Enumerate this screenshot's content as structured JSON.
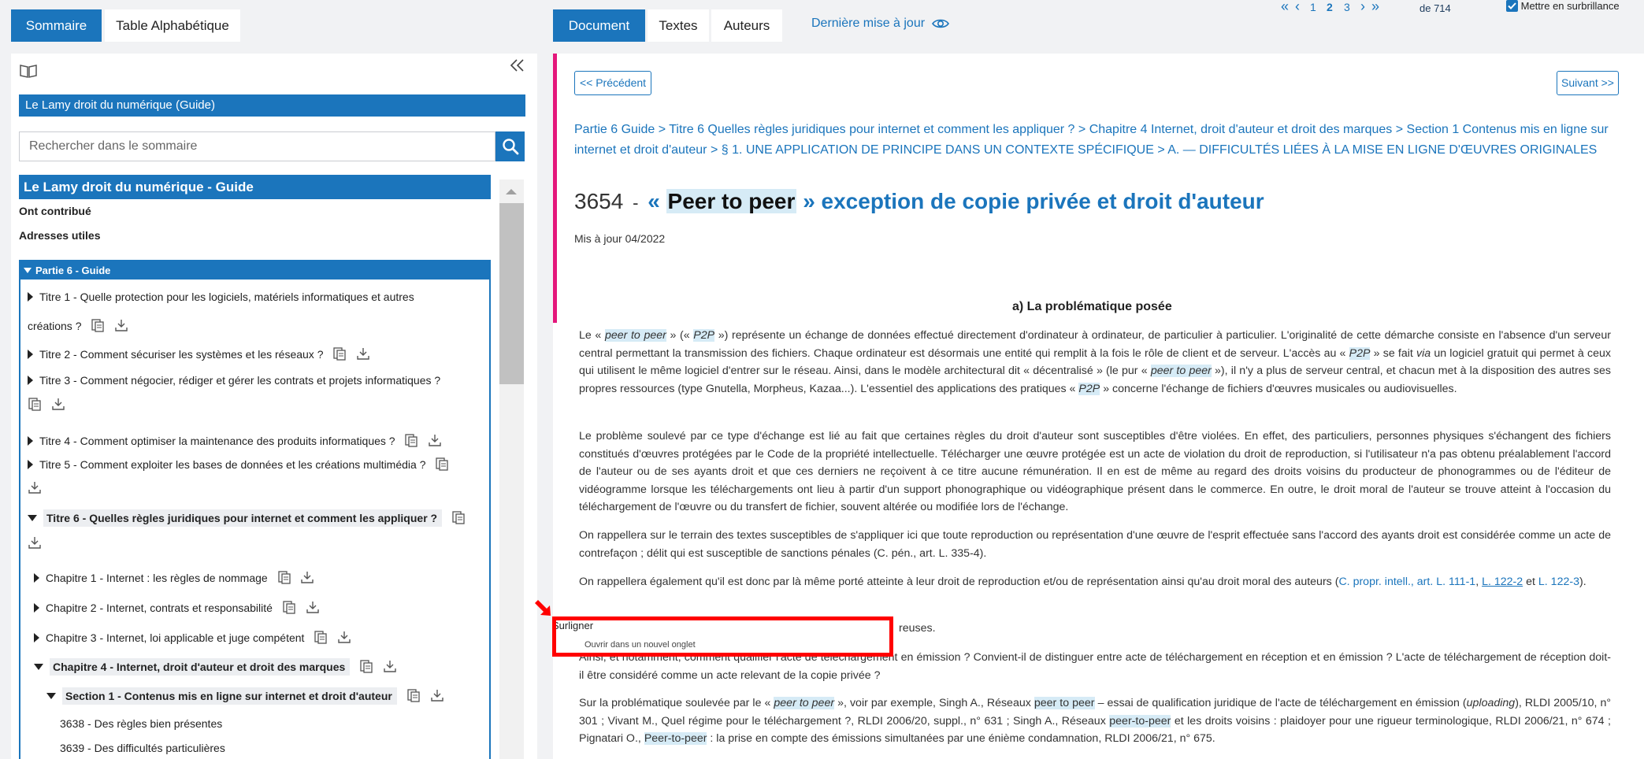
{
  "left_tabs": [
    "Sommaire",
    "Table Alphabétique"
  ],
  "right_tabs": [
    "Document",
    "Textes",
    "Auteurs"
  ],
  "last_update_label": "Dernière mise à jour",
  "pager": {
    "pages": [
      "1",
      "2",
      "3"
    ],
    "current": "2",
    "total": "de 714"
  },
  "highlight_checkbox": {
    "label": "Mettre en surbrillance",
    "checked": true
  },
  "sidebar": {
    "book_title": "Le Lamy droit du numérique (Guide)",
    "search_placeholder": "Rechercher dans le sommaire",
    "toc_header": "Le Lamy droit du numérique - Guide",
    "links": [
      "Ont contribué",
      "Adresses utiles"
    ],
    "part_label": "Partie 6 - Guide",
    "titles": [
      {
        "line1": "Titre 1 - Quelle protection pour les logiciels, matériels informatiques et autres",
        "line2": "créations ?"
      },
      {
        "line1": "Titre 2 - Comment sécuriser les systèmes et les réseaux ?"
      },
      {
        "line1": "Titre 3 - Comment négocier, rédiger et gérer les contrats et projets informatiques ?"
      },
      {
        "line1": "Titre 4 - Comment optimiser la maintenance des produits informatiques ?"
      },
      {
        "line1": "Titre 5 - Comment exploiter les bases de données et les créations multimédia ?"
      },
      {
        "line1": "Titre 6 - Quelles règles juridiques pour internet et comment les appliquer ?"
      }
    ],
    "chapters": [
      "Chapitre 1 - Internet : les règles de nommage",
      "Chapitre 2 - Internet, contrats et responsabilité",
      "Chapitre 3 - Internet, loi applicable et juge compétent",
      "Chapitre 4 - Internet, droit d'auteur et droit des marques"
    ],
    "section": "Section 1 - Contenus mis en ligne sur internet et droit d'auteur",
    "items": [
      "3638 - Des règles bien présentes",
      "3639 - Des difficultés particulières"
    ]
  },
  "doc": {
    "prev": "<< Précédent",
    "next": "Suivant >>",
    "breadcrumb": "Partie 6 Guide > Titre 6 Quelles règles juridiques pour internet et comment les appliquer ? > Chapitre 4 Internet, droit d'auteur et droit des marques > Section 1 Contenus mis en ligne sur internet et droit d'auteur > § 1. UNE APPLICATION DE PRINCIPE DANS UN CONTEXTE SPÉCIFIQUE > A. — DIFFICULTÉS LIÉES À LA MISE EN LIGNE D'ŒUVRES ORIGINALES",
    "number": "3654",
    "dash": "-",
    "title_open": "«",
    "title_kw": "Peer to peer",
    "title_rest": "» exception de copie privée et droit d'auteur",
    "updated": "Mis à jour 04/2022",
    "section_heading": "a) La problématique posée",
    "p1": {
      "t1": "Le «",
      "k1": "peer to peer",
      "t2": "» («",
      "k2": "P2P",
      "t3": "») représente un échange de données effectué directement d'ordinateur à ordinateur, de particulier à particulier. L'originalité de cette démarche consiste en l'absence d'un serveur central permettant la transmission des fichiers. Chaque ordinateur est désormais une entité qui remplit à la fois le rôle de client et de serveur. L'accès au «",
      "k3": "P2P",
      "t4": "» se fait",
      "via": "via",
      "t5": "un logiciel gratuit qui permet à ceux qui utilisent le même logiciel d'entrer sur le réseau. Ainsi, dans le modèle architectural dit « décentralisé » (le pur «",
      "k4": "peer to peer",
      "t6": "»), il n'y a plus de serveur central, et chacun met à la disposition des autres ses propres ressources (type Gnutella, Morpheus, Kazaa...). L'essentiel des applications des pratiques «",
      "k5": "P2P",
      "t7": "» concerne l'échange de fichiers d'œuvres musicales ou audiovisuelles."
    },
    "p2": "Le problème soulevé par ce type d'échange est lié au fait que certaines règles du droit d'auteur sont susceptibles d'être violées. En effet, des particuliers, personnes physiques s'échangent des fichiers constitués d'œuvres protégées par le Code de la propriété intellectuelle. Télécharger une œuvre protégée est un acte de violation du droit de reproduction, si l'utilisateur n'a pas obtenu préalablement l'accord de l'auteur ou de ses ayants droit et que ces derniers ne reçoivent à ce titre aucune rémunération. Il en est de même au regard des droits voisins du producteur de phonogrammes ou de l'éditeur de vidéogramme lorsque les téléchargements ont lieu à partir d'un support phonographique ou vidéographique présent dans le commerce. En outre, le droit moral de l'auteur se trouve atteint à l'occasion du téléchargement de l'œuvre ou du transfert de fichier, souvent altérée ou modifiée lors de l'échange.",
    "p3": "On rappellera sur le terrain des textes susceptibles de s'appliquer ici que toute reproduction ou représentation d'une œuvre de l'esprit effectuée sans l'accord des ayants droit est considérée comme un acte de contrefaçon ; délit qui est susceptible de sanctions pénales (C. pén., art. L. 335-4).",
    "p4": {
      "t1": "On rappellera également qu'il est donc par là même porté atteinte à leur droit de reproduction et/ou de représentation ainsi qu'au droit moral des auteurs (",
      "l1": "C. propr. intell., art. L. 111-1",
      "t2": ",",
      "l2": "L. 122-2",
      "t3": "et",
      "l3": "L. 122-3",
      "t4": ")."
    },
    "p5_tail": "reuses.",
    "p6": "Ainsi, et notamment, comment qualifier l'acte de téléchargement en émission ? Convient-il de distinguer entre acte de téléchargement en réception et en émission ? L'acte de téléchargement de réception doit-il être considéré comme un acte relevant de la copie privée ?",
    "p7": {
      "t1": "Sur la problématique soulevée par le «",
      "k1": "peer to peer",
      "t2": "», voir par exemple, Singh A., Réseaux",
      "k2": "peer to peer",
      "t3": "– essai de qualification juridique de l'acte de téléchargement en émission (",
      "up": "uploading",
      "t4": "), RLDI 2005/10, n° 301 ; Vivant M., Quel régime pour le téléchargement ?, RLDI 2006/20, suppl., n° 631 ; Singh A., Réseaux",
      "k3": "peer-to-peer",
      "t5": "et les droits voisins : plaidoyer pour une rigueur terminologique, RLDI 2006/21, n° 674 ; Pignatari O.,",
      "k4": "Peer-to-peer",
      "t6": ": la prise en compte des émissions simultanées par une énième condamnation, RLDI 2006/21, n° 675."
    }
  },
  "context_menu": {
    "item1": "Surligner",
    "item2": "Ouvrir dans un nouvel onglet"
  }
}
